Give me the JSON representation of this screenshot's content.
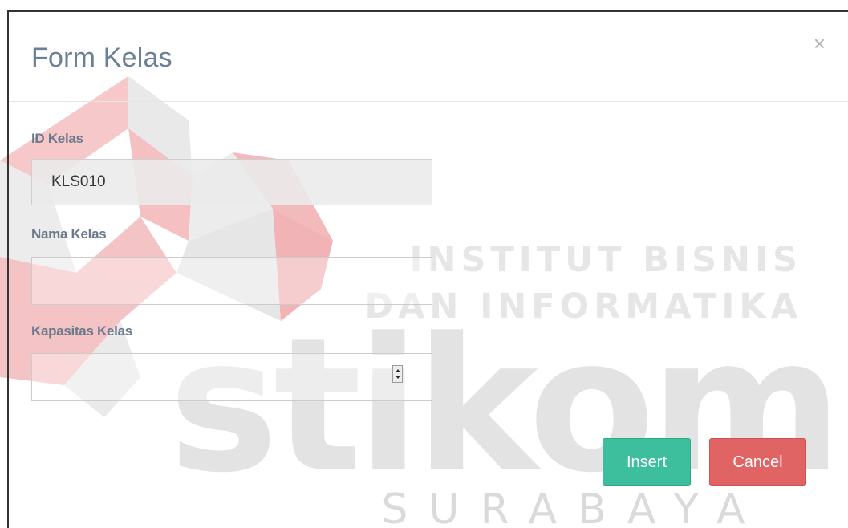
{
  "modal": {
    "title": "Form Kelas",
    "close_glyph": "×",
    "close_icon": "close-icon"
  },
  "form": {
    "id_kelas": {
      "label": "ID Kelas",
      "value": "KLS010"
    },
    "nama_kelas": {
      "label": "Nama Kelas",
      "value": "",
      "placeholder": ""
    },
    "kapasitas_kelas": {
      "label": "Kapasitas Kelas",
      "value": "",
      "placeholder": ""
    }
  },
  "actions": {
    "insert_label": "Insert",
    "cancel_label": "Cancel"
  },
  "watermark": {
    "line1": "INSTITUT BISNIS",
    "line2": "DAN INFORMATIKA",
    "brand": "stikom",
    "city": "SURABAYA"
  },
  "colors": {
    "title": "#6b8096",
    "label": "#6b7a8c",
    "insert": "#3dbf9e",
    "cancel": "#e06464",
    "watermark_red": "#f2b6b8",
    "watermark_gray": "#e3e3e3"
  }
}
